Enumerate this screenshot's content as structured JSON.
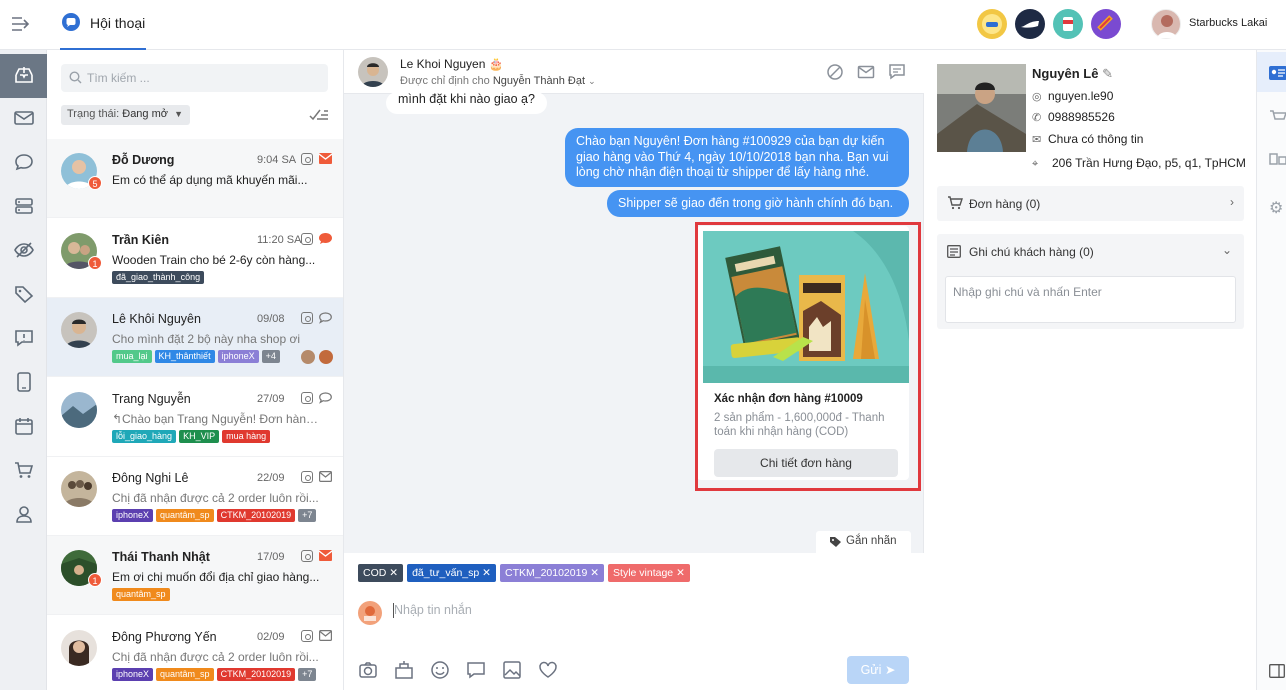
{
  "topbar": {
    "tab_label": "Hội thoại",
    "account_name": "Starbucks Lakai"
  },
  "list": {
    "search_placeholder": "Tìm kiếm ...",
    "filter_label": "Trạng thái:",
    "filter_value": "Đang mở",
    "conversations": [
      {
        "name": "Đỗ Dương",
        "time": "9:04 SA",
        "message": "Em có thể áp dụng mã khuyến mãi...",
        "unread": "5",
        "tags": []
      },
      {
        "name": "Trần Kiên",
        "time": "11:20 SA",
        "message": "Wooden Train cho bé 2-6y còn hàng...",
        "unread": "1",
        "tags": [
          "đã_giao_thành_công"
        ]
      },
      {
        "name": "Lê Khôi Nguyên",
        "time": "09/08",
        "message": "Cho mình đặt 2 bộ này nha shop ơi",
        "tags": [
          "mua_lại",
          "KH_thânthiết",
          "iphoneX",
          "+4"
        ]
      },
      {
        "name": "Trang Nguyễn",
        "time": "27/09",
        "message": "Chào bạn Trang Nguyễn! Đơn hàng...",
        "tags": [
          "lỗi_giao_hàng",
          "KH_VIP",
          "mua hàng"
        ]
      },
      {
        "name": "Đông Nghi Lê",
        "time": "22/09",
        "message": "Chị đã nhận được cả 2 order luôn rồi...",
        "tags": [
          "iphoneX",
          "quantâm_sp",
          "CTKM_20102019",
          "+7"
        ]
      },
      {
        "name": "Thái Thanh Nhật",
        "time": "17/09",
        "message": "Em ơi chị muốn đổi địa chỉ giao hàng...",
        "unread": "1",
        "tags": [
          "quantâm_sp"
        ]
      },
      {
        "name": "Đông Phương Yến",
        "time": "02/09",
        "message": "Chị đã nhận được cả 2 order luôn rồi...",
        "tags": [
          "iphoneX",
          "quantâm_sp",
          "CTKM_20102019",
          "+7"
        ]
      }
    ]
  },
  "chat": {
    "contact_name": "Le Khoi Nguyen",
    "assigned_prefix": "Được chỉ định cho",
    "assigned_to": "Nguyễn Thành Đạt",
    "messages": [
      {
        "dir": "in",
        "text": "mình đặt khi nào giao ạ?"
      },
      {
        "dir": "out",
        "lines": [
          "Chào bạn Nguyên! Đơn hàng #100929 của bạn dự kiến",
          "giao hàng vào Thứ 4, ngày 10/10/2018 bạn nha. Bạn vui",
          "lòng chờ nhận điện thoại từ shipper để lấy hàng nhé."
        ]
      },
      {
        "dir": "out",
        "text": "Shipper sẽ giao đến trong giờ hành chính đó bạn."
      }
    ],
    "product_card": {
      "title": "Xác nhận đơn hàng #10009",
      "description": "2 sản phẩm - 1,600,000đ - Thanh toán khi nhận hàng (COD)",
      "button": "Chi tiết đơn hàng"
    },
    "label_button": "Gắn nhãn",
    "composer_tags": [
      {
        "label": "COD",
        "color": "#3d4b5c"
      },
      {
        "label": "đã_tư_vấn_sp",
        "color": "#1f5fbf"
      },
      {
        "label": "CTKM_20102019",
        "color": "#8b7fd6"
      },
      {
        "label": "Style vintage",
        "color": "#ef6b6b"
      }
    ],
    "input_placeholder": "Nhập tin nhắn",
    "send_label": "Gửi"
  },
  "profile": {
    "name": "Nguyên Lê",
    "instagram": "nguyen.le90",
    "phone": "0988985526",
    "email": "Chưa có thông tin",
    "address": "206 Trần Hưng Đạo, p5, q1, TpHCM",
    "orders_label": "Đơn hàng (0)",
    "notes_label": "Ghi chú khách hàng (0)",
    "notes_placeholder": "Nhập ghi chú và nhấn Enter"
  },
  "colors": {
    "accent": "#2f6fd3",
    "bubble_out": "#4694f2",
    "highlight": "#e0393e"
  }
}
